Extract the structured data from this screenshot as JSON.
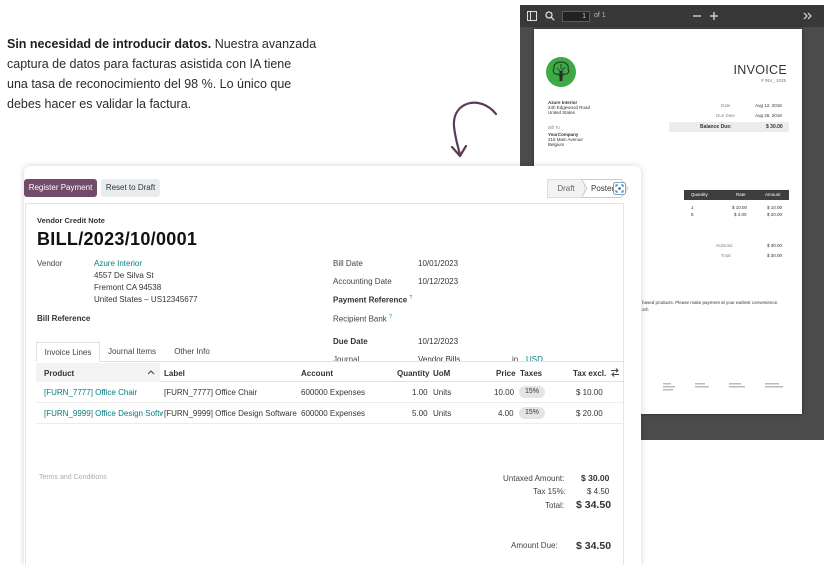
{
  "marketing": {
    "bold_text": "Sin necesidad de introducir datos.",
    "text_line1_rest": " Nuestra avanzada",
    "line2": "captura de datos para facturas asistida con IA tiene",
    "line3": "una tasa de reconocimiento del 98 %. Lo único que",
    "line4": "debes hacer es validar la factura."
  },
  "pdf": {
    "page_value": "1",
    "page_of": "of 1",
    "title": "INVOICE",
    "number": "# INV_ 1025",
    "from": [
      "Azure Interior",
      "24h Edgewood Road",
      "United States"
    ],
    "bill_to_label": "Bill To",
    "bill_to": [
      "YourCompany",
      "215 Main Avenue",
      "Belgium"
    ],
    "date_label": "Date",
    "date_value": "Aug 12, 2018",
    "due_label": "Due Date",
    "due_value": "Aug 26, 2018",
    "balance_label": "Balance Due:",
    "balance_value": "$ 30.00",
    "col_qty": "Quantity",
    "col_rate": "Rate",
    "col_amount": "Amount",
    "rows": [
      {
        "qty": "1",
        "rate": "$ 10.00",
        "amount": "$ 10.00"
      },
      {
        "qty": "5",
        "rate": "$ 4.00",
        "amount": "$ 20.00"
      }
    ],
    "subtotal_label": "Subtotal",
    "subtotal_value": "$ 30.00",
    "total_label": "Total",
    "total_value": "$ 30.00",
    "note_line1": "hased products. Please make payment at your earliest convenience.",
    "note_line2": "orh"
  },
  "buttons": {
    "register": "Register Payment",
    "reset": "Reset to Draft"
  },
  "status": {
    "draft": "Draft",
    "posted": "Posted"
  },
  "form": {
    "doc_type": "Vendor Credit Note",
    "title": "BILL/2023/10/0001",
    "vendor_label": "Vendor",
    "vendor_name": "Azure Interior",
    "vendor_address": [
      "4557 De Silva St",
      "Fremont CA 94538",
      "United States – US12345677"
    ],
    "bill_reference_label": "Bill Reference",
    "bill_date_label": "Bill Date",
    "bill_date_value": "10/01/2023",
    "accounting_date_label": "Accounting Date",
    "accounting_date_value": "10/12/2023",
    "payment_reference_label": "Payment Reference",
    "recipient_bank_label": "Recipient Bank",
    "due_date_label": "Due Date",
    "due_date_value": "10/12/2023",
    "journal_label": "Journal",
    "journal_value": "Vendor Bills",
    "in_label": "in",
    "currency": "USD",
    "help_mark": "?"
  },
  "tabs": [
    "Invoice Lines",
    "Journal Items",
    "Other Info"
  ],
  "table": {
    "headers": {
      "product": "Product",
      "label": "Label",
      "account": "Account",
      "quantity": "Quantity",
      "uom": "UoM",
      "price": "Price",
      "taxes": "Taxes",
      "tax_excl": "Tax excl."
    },
    "rows": [
      {
        "product": "[FURN_7777] Office Chair",
        "label": "[FURN_7777] Office Chair",
        "account": "600000 Expenses",
        "quantity": "1.00",
        "uom": "Units",
        "price": "10.00",
        "tax": "15%",
        "tax_excl": "$ 10.00"
      },
      {
        "product": "[FURN_9999] Office Design Softw",
        "label": "[FURN_9999] Office Design Software",
        "account": "600000 Expenses",
        "quantity": "5.00",
        "uom": "Units",
        "price": "4.00",
        "tax": "15%",
        "tax_excl": "$ 20.00"
      }
    ]
  },
  "terms_placeholder": "Terms and Conditions",
  "totals": {
    "untaxed_label": "Untaxed Amount:",
    "untaxed_value": "$ 30.00",
    "tax_label": "Tax 15%:",
    "tax_value": "$ 4.50",
    "total_label": "Total:",
    "total_value": "$ 34.50",
    "amount_due_label": "Amount Due:",
    "amount_due_value": "$ 34.50"
  },
  "colors": {
    "primary": "#714b67",
    "link": "#017e84",
    "logo_green": "#3daa46"
  }
}
